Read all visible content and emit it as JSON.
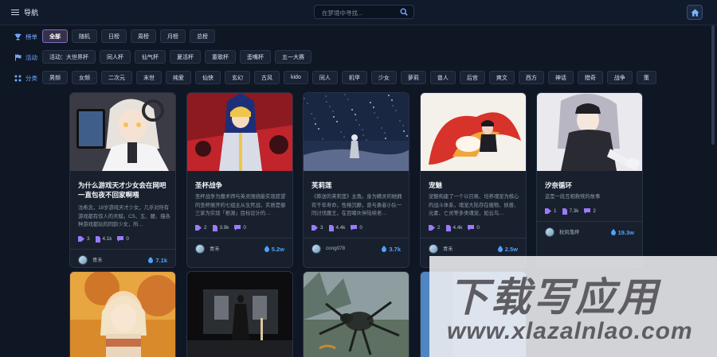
{
  "header": {
    "nav_label": "导航",
    "search_placeholder": "在梦境中寻找..."
  },
  "filters": {
    "rank": {
      "label": "榜单",
      "chips": [
        "全部",
        "随机",
        "日榜",
        "周榜",
        "月榜",
        "总榜"
      ],
      "active": "全部"
    },
    "event": {
      "label": "活动",
      "chips": [
        "活动：大世界杯",
        "同人杯",
        "仙气杯",
        "夏活杯",
        "童歌杯",
        "歪嘴杯",
        "五一大赛"
      ]
    },
    "category": {
      "label": "分类",
      "chips": [
        "男频",
        "女频",
        "二次元",
        "末世",
        "纯爱",
        "仙侠",
        "玄幻",
        "古风",
        "kido",
        "同人",
        "机甲",
        "少女",
        "萝莉",
        "兽人",
        "后宫",
        "爽文",
        "西方",
        "神话",
        "猎奇",
        "战争",
        "策"
      ]
    }
  },
  "cards": [
    {
      "title": "为什么游戏天才少女会在网吧一直包夜不回家啊喂",
      "desc": "沈希念，18岁游戏天才少女，几乎对所有游戏都有惊人的天赋。CS、五、腰、撸各种游戏都玩的同龄少女，所…",
      "chapters": "3",
      "words": "4.1k",
      "likes": "0",
      "author": "青禾",
      "heat": "7.1k",
      "palette": [
        "#e8e2dc",
        "#3b3b46",
        "#f1c25a"
      ]
    },
    {
      "title": "圣杯战争",
      "desc": "圣杯战争为魔术师与英灵围绕能实现愿望的圣杯展开的七组主从生死战，实质是御三家为实现「根源」目标设计的…",
      "chapters": "2",
      "words": "3.9k",
      "likes": "0",
      "author": "青禾",
      "heat": "5.2w",
      "palette": [
        "#c1242b",
        "#1e2f7a",
        "#f0c64a"
      ]
    },
    {
      "title": "芙莉莲",
      "desc": "《葬送的芙莉莲》主角。身为精灵的她拥有千年寿命，性格沉静，曾与勇者小队一同讨伐魔王，在目睹伙伴陆续老…",
      "chapters": "3",
      "words": "4.4k",
      "likes": "0",
      "author": "cong078",
      "heat": "3.7k",
      "palette": [
        "#22304f",
        "#5d6c8e",
        "#c7cbd6"
      ]
    },
    {
      "title": "宠魅",
      "desc": "宠魅构建了一个以召唤、培养魂宠为核心的战斗体系，魂宠大陆存在植物、妖兽、元素、亡灵等多类魂宠，如云鸟…",
      "chapters": "2",
      "words": "4.4k",
      "likes": "0",
      "author": "青禾",
      "heat": "2.5w",
      "palette": [
        "#f4f0ea",
        "#d8332a",
        "#f0a63c"
      ]
    },
    {
      "title": "汐奈循环",
      "desc": "这是一段互相救赎的故事",
      "chapters": "1",
      "words": "7.3k",
      "likes": "2",
      "author": "秋风落烨",
      "heat": "19.3w",
      "palette": [
        "#e9e9ee",
        "#2a2a33",
        "#b9b6c4"
      ]
    }
  ],
  "watermark": {
    "big": "下载写应用",
    "small": "www.xlazalnlao.com"
  },
  "colors": {
    "accent": "#4da3ff",
    "active_chip": "#37304d"
  }
}
